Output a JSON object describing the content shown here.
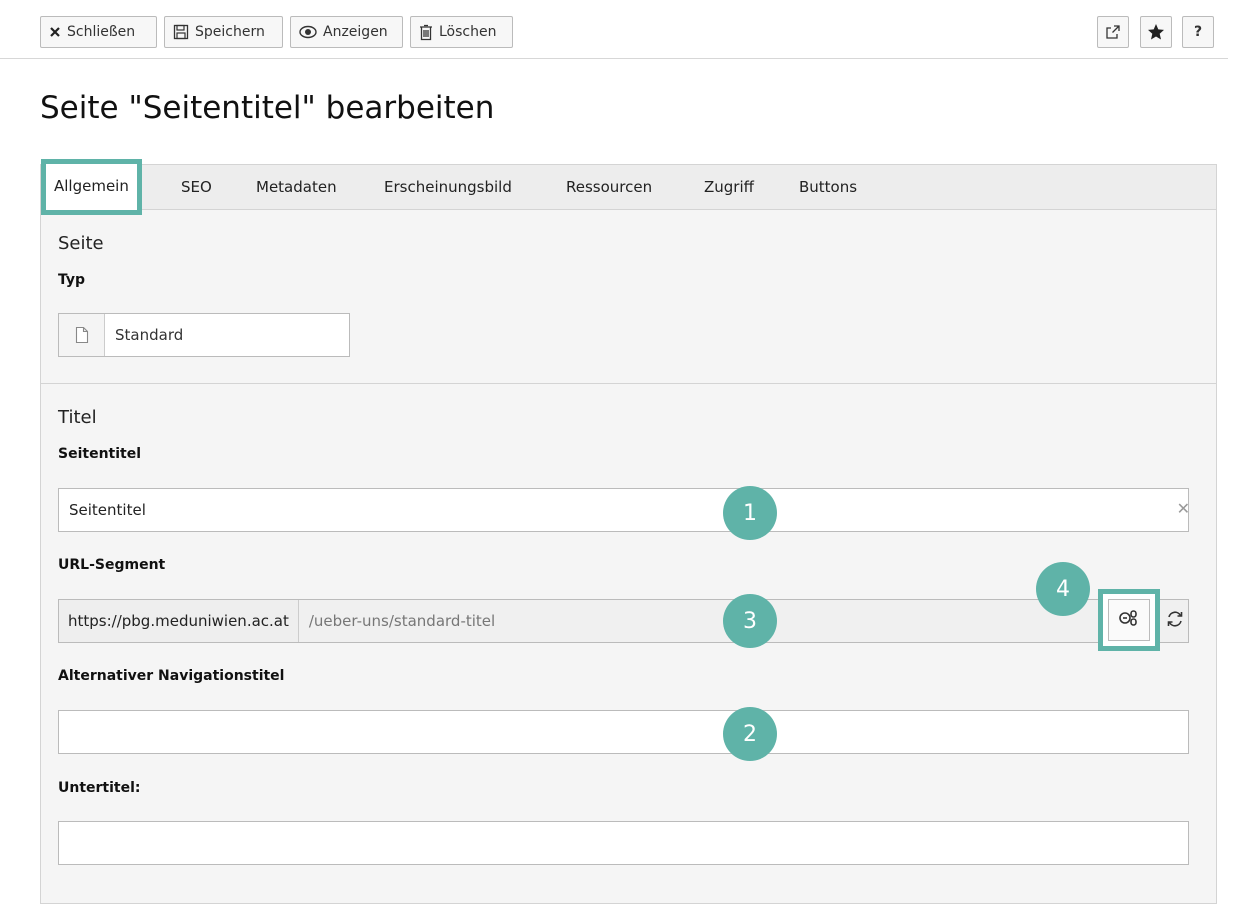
{
  "toolbar": {
    "close_label": "Schließen",
    "save_label": "Speichern",
    "view_label": "Anzeigen",
    "delete_label": "Löschen",
    "help_label": "?"
  },
  "page_title": "Seite \"Seitentitel\" bearbeiten",
  "tabs": [
    {
      "label": "Allgemein",
      "active": true
    },
    {
      "label": "SEO"
    },
    {
      "label": "Metadaten"
    },
    {
      "label": "Erscheinungsbild"
    },
    {
      "label": "Ressourcen"
    },
    {
      "label": "Zugriff"
    },
    {
      "label": "Buttons"
    }
  ],
  "sections": {
    "seite": {
      "title": "Seite",
      "type_label": "Typ",
      "type_value": "Standard"
    },
    "titel": {
      "title": "Titel",
      "page_title_label": "Seitentitel",
      "page_title_value": "Seitentitel",
      "url_label": "URL-Segment",
      "url_prefix": "https://pbg.meduniwien.ac.at",
      "url_path": "/ueber-uns/standard-titel",
      "nav_title_label": "Alternativer Navigationstitel",
      "nav_title_value": "",
      "subtitle_label": "Untertitel:",
      "subtitle_value": ""
    }
  },
  "badges": {
    "b1": "1",
    "b2": "2",
    "b3": "3",
    "b4": "4"
  },
  "colors": {
    "accent": "#5fb3a8"
  },
  "icons": [
    "close-icon",
    "save-icon",
    "eye-icon",
    "trash-icon",
    "external-link-icon",
    "star-icon",
    "file-icon",
    "unlink-icon",
    "refresh-icon"
  ]
}
